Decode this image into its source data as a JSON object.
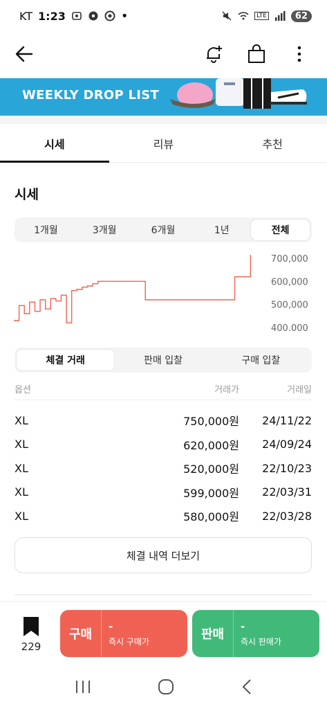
{
  "status_bar": {
    "carrier": "KT",
    "time": "1:23",
    "network": "LTE",
    "battery": "62"
  },
  "banner": {
    "text": "WEEKLY DROP LIST"
  },
  "tabs": [
    {
      "label": "시세",
      "active": true
    },
    {
      "label": "리뷰",
      "active": false
    },
    {
      "label": "추천",
      "active": false
    }
  ],
  "section_title": "시세",
  "periods": [
    {
      "label": "1개월",
      "active": false
    },
    {
      "label": "3개월",
      "active": false
    },
    {
      "label": "6개월",
      "active": false
    },
    {
      "label": "1년",
      "active": false
    },
    {
      "label": "전체",
      "active": true
    }
  ],
  "chart_data": {
    "type": "line",
    "title": "",
    "xlabel": "",
    "ylabel": "",
    "y_tick_labels": [
      "700,000",
      "600,000",
      "500,000",
      "400,000"
    ],
    "y_ticks": [
      700000,
      600000,
      500000,
      400000
    ],
    "ylim": [
      385000,
      715000
    ],
    "grid": false,
    "color": "#ef6253",
    "series": [
      {
        "values": [
          430000,
          495000,
          460000,
          510000,
          470000,
          520000,
          480000,
          525000,
          515000,
          540000,
          420000,
          560000,
          565000,
          575000,
          580000,
          590000,
          600000,
          600000,
          600000,
          600000,
          600000,
          600000,
          600000,
          600000,
          600000,
          520000,
          520000,
          520000,
          520000,
          520000,
          520000,
          520000,
          520000,
          520000,
          520000,
          520000,
          520000,
          520000,
          520000,
          520000,
          520000,
          520000,
          620000,
          620000,
          620000,
          750000,
          750000
        ]
      }
    ]
  },
  "trade_tabs": [
    {
      "label": "체결 거래",
      "active": true
    },
    {
      "label": "판매 입찰",
      "active": false
    },
    {
      "label": "구매 입찰",
      "active": false
    }
  ],
  "table": {
    "headers": {
      "option": "옵션",
      "price": "거래가",
      "date": "거래일"
    },
    "rows": [
      {
        "option": "XL",
        "price": "750,000원",
        "date": "24/11/22"
      },
      {
        "option": "XL",
        "price": "620,000원",
        "date": "24/09/24"
      },
      {
        "option": "XL",
        "price": "520,000원",
        "date": "22/10/23"
      },
      {
        "option": "XL",
        "price": "599,000원",
        "date": "22/03/31"
      },
      {
        "option": "XL",
        "price": "580,000원",
        "date": "22/03/28"
      }
    ]
  },
  "more_button": "체결 내역 더보기",
  "bottom_bar": {
    "wish_count": "229",
    "buy": {
      "label": "구매",
      "price": "-",
      "sub": "즉시 구매가",
      "color": "#ef6253"
    },
    "sell": {
      "label": "판매",
      "price": "-",
      "sub": "즉시 판매가",
      "color": "#41b979"
    }
  },
  "icons": {
    "back": "arrow-left-icon",
    "alert": "bell-plus-icon",
    "bag": "shopping-bag-icon",
    "more": "kebab-menu-icon",
    "bookmark": "bookmark-icon",
    "nav_recents": "recents-icon",
    "nav_home": "home-icon",
    "nav_back": "nav-back-icon"
  }
}
